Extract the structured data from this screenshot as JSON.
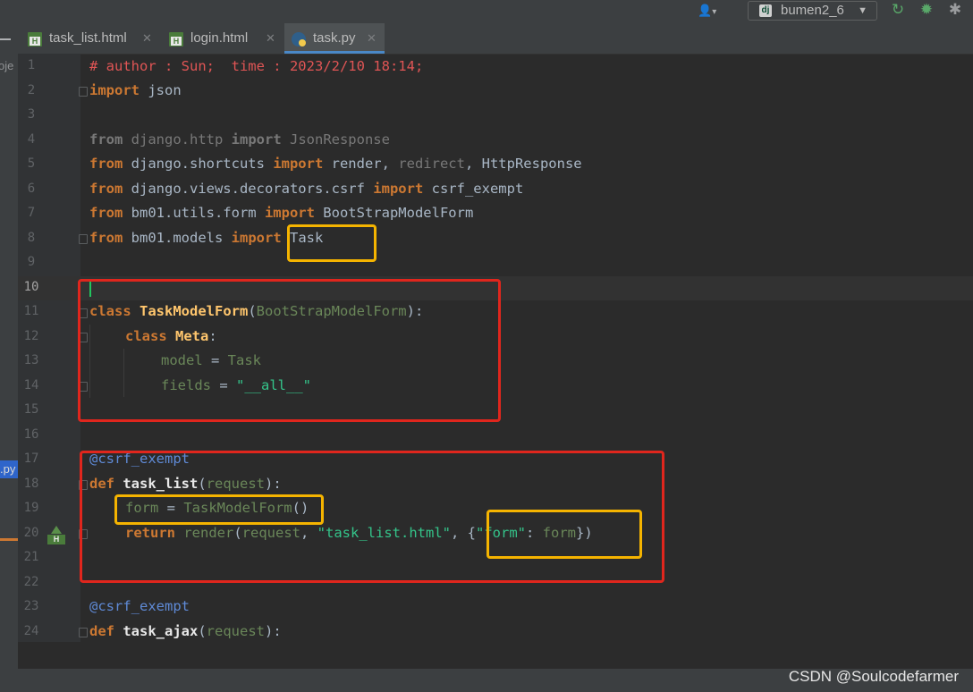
{
  "toolbar": {
    "user_icon": "user-icon",
    "run_config": "bumen2_6",
    "config_badge": "dj",
    "rerun_icon": "rerun-icon",
    "debug_icon": "debug-bug-icon",
    "extra_icon": "bug-icon"
  },
  "tabs": [
    {
      "label": "task_list.html",
      "icon": "html-file-icon",
      "close": "✕",
      "active": false
    },
    {
      "label": "login.html",
      "icon": "html-file-icon",
      "close": "✕",
      "active": false
    },
    {
      "label": "task.py",
      "icon": "python-file-icon",
      "close": "✕",
      "active": true
    }
  ],
  "project_strip": {
    "top_fragment": "oje",
    "file_fragment": ".py"
  },
  "editor": {
    "line_numbers": [
      "1",
      "2",
      "3",
      "4",
      "5",
      "6",
      "7",
      "8",
      "9",
      "10",
      "11",
      "12",
      "13",
      "14",
      "15",
      "16",
      "17",
      "18",
      "19",
      "20",
      "21",
      "22",
      "23",
      "24"
    ],
    "current_line": "10",
    "lines": {
      "l1": "# author : Sun;  time : 2023/2/10 18:14;",
      "l2_kw": "import",
      "l2_mod": " json",
      "l4_kw1": "from",
      "l4_mod": " django.http ",
      "l4_kw2": "import",
      "l4_name": " JsonResponse",
      "l5_kw1": "from",
      "l5_mod": " django.shortcuts ",
      "l5_kw2": "import",
      "l5_a": " render",
      "l5_sep1": ", ",
      "l5_b": "redirect",
      "l5_sep2": ", ",
      "l5_c": "HttpResponse",
      "l6_kw1": "from",
      "l6_mod": " django.views.decorators.csrf ",
      "l6_kw2": "import",
      "l6_name": " csrf_exempt",
      "l7_kw1": "from",
      "l7_mod": " bm01.utils.form ",
      "l7_kw2": "import",
      "l7_name": " BootStrapModelForm",
      "l8_kw1": "from",
      "l8_mod": " bm01.models ",
      "l8_kw2": "import",
      "l8_name": " Task",
      "l11_kw": "class",
      "l11_name": " TaskModelForm",
      "l11_open": "(",
      "l11_base": "BootStrapModelForm",
      "l11_close": "):",
      "l12_kw": "class",
      "l12_name": " Meta",
      "l12_colon": ":",
      "l13_a": "model",
      "l13_eq": " = ",
      "l13_b": "Task",
      "l14_a": "fields",
      "l14_eq": " = ",
      "l14_str": "\"__all__\"",
      "l17": "@csrf_exempt",
      "l18_kw": "def",
      "l18_name": " task_list",
      "l18_open": "(",
      "l18_param": "request",
      "l18_close": "):",
      "l19_a": "form",
      "l19_eq": " = ",
      "l19_call": "TaskModelForm",
      "l19_paren": "()",
      "l20_kw": "return",
      "l20_fn": " render",
      "l20_open": "(",
      "l20_arg": "request",
      "l20_c1": ", ",
      "l20_str": "\"task_list.html\"",
      "l20_c2": ", ",
      "l20_brace": "{",
      "l20_key": "\"form\"",
      "l20_colon": ": ",
      "l20_val": "form",
      "l20_end": "})",
      "l23": "@csrf_exempt",
      "l24_kw": "def",
      "l24_name": " task_ajax",
      "l24_open": "(",
      "l24_param": "request",
      "l24_close": "):"
    }
  },
  "colors": {
    "keyword": "#cc7832",
    "comment": "#e05555",
    "string": "#6a8759",
    "decorator": "#5f8ad6",
    "annotation_red": "#e0261d",
    "annotation_yellow": "#f5b400",
    "active_tab_underline": "#4a88c7"
  },
  "watermark": "CSDN @Soulcodefarmer"
}
